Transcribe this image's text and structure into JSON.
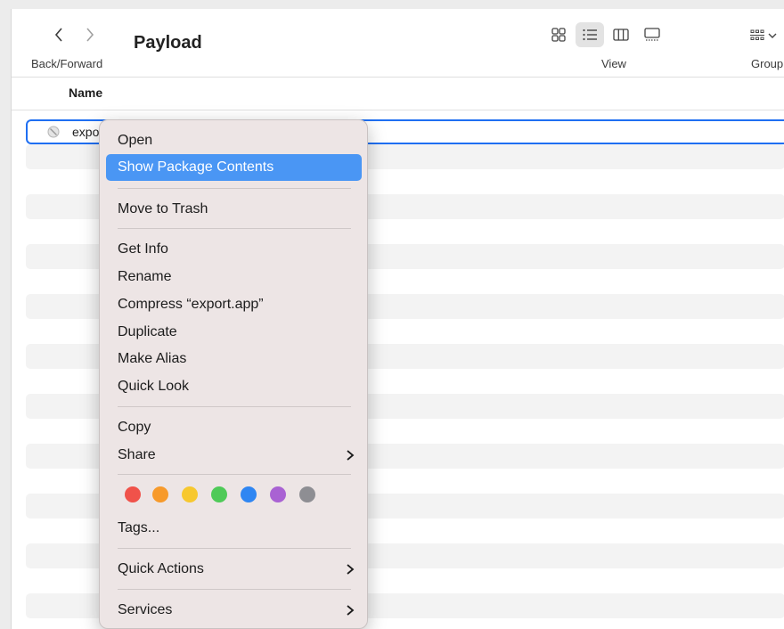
{
  "toolbar": {
    "back_icon": "chevron-left-icon",
    "forward_icon": "chevron-right-icon",
    "nav_label": "Back/Forward",
    "title": "Payload",
    "view_label": "View",
    "group_label": "Group",
    "view_modes": [
      "icon-view-icon",
      "list-view-icon",
      "column-view-icon",
      "gallery-view-icon"
    ],
    "active_view": "list"
  },
  "list": {
    "column_header": "Name",
    "selected_item": "expo"
  },
  "context_menu": {
    "open": "Open",
    "show_package_contents": "Show Package Contents",
    "move_to_trash": "Move to Trash",
    "get_info": "Get Info",
    "rename": "Rename",
    "compress": "Compress “export.app”",
    "duplicate": "Duplicate",
    "make_alias": "Make Alias",
    "quick_look": "Quick Look",
    "copy": "Copy",
    "share": "Share",
    "tags": "Tags...",
    "quick_actions": "Quick Actions",
    "services": "Services",
    "highlight_color": "#4a96f4",
    "tag_colors": [
      "#f0524a",
      "#f79a2b",
      "#f7c82f",
      "#4fca58",
      "#2f86f2",
      "#a962d3",
      "#8e8e93"
    ]
  }
}
